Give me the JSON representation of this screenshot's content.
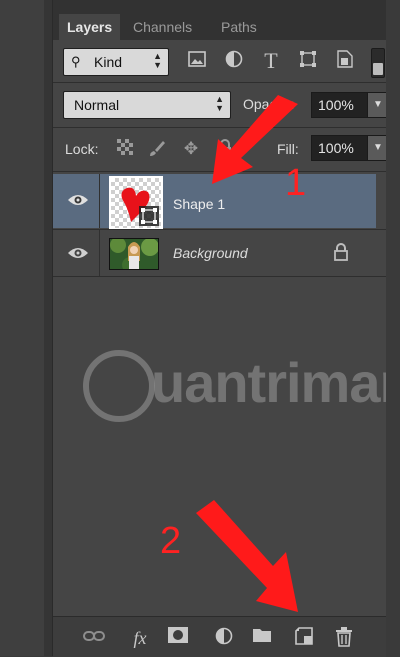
{
  "tabs": [
    {
      "label": "Layers",
      "active": true
    },
    {
      "label": "Channels",
      "active": false
    },
    {
      "label": "Paths",
      "active": false
    }
  ],
  "panel_menu": "≡",
  "filter": {
    "kind_icon": "search-icon",
    "kind_label": "Kind",
    "icons": [
      "image-filter-icon",
      "adjustment-filter-icon",
      "type-filter-icon",
      "shape-filter-icon",
      "smart-object-filter-icon"
    ]
  },
  "blend": {
    "mode": "Normal",
    "opacity_label": "Opacity:",
    "opacity_value": "100%"
  },
  "lock": {
    "label": "Lock:",
    "icons": [
      "lock-transparent-icon",
      "lock-image-icon",
      "lock-position-icon",
      "lock-all-icon"
    ],
    "fill_label": "Fill:",
    "fill_value": "100%"
  },
  "layers": [
    {
      "name": "Shape 1",
      "visible": true,
      "selected": true,
      "type": "shape"
    },
    {
      "name": "Background",
      "visible": true,
      "selected": false,
      "locked": true,
      "type": "image"
    }
  ],
  "bottom_icons": [
    "link-layers-icon",
    "fx-icon",
    "add-mask-icon",
    "adjustment-layer-icon",
    "group-folder-icon",
    "new-layer-icon",
    "trash-icon"
  ],
  "bottom_labels": {
    "fx": "fx"
  },
  "annotations": {
    "one": "1",
    "two": "2"
  },
  "watermark": "uantrimang",
  "colors": {
    "selected_row": "#5a6b80",
    "arrow": "#ff1a1a",
    "panel_bg": "#454545"
  }
}
